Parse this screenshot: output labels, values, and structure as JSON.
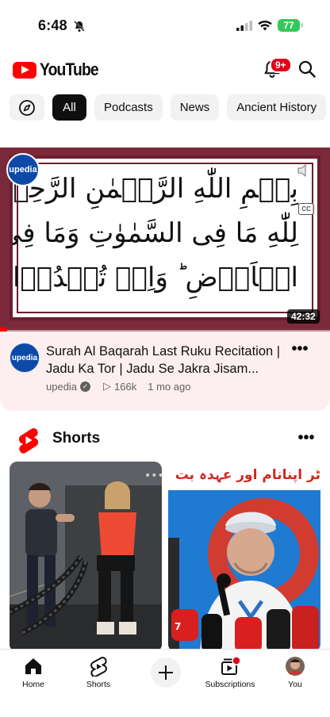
{
  "status_bar": {
    "time": "6:48",
    "battery": "77",
    "mute_icon": "bell-slash-icon",
    "signal_icon": "cellular-signal-icon",
    "wifi_icon": "wifi-icon"
  },
  "header": {
    "logo_text": "YouTube",
    "notification_count": "9+",
    "bell_icon": "bell-icon",
    "search_icon": "search-icon",
    "brand_color": "#ff0000"
  },
  "chips": {
    "explore_icon": "compass-icon",
    "items": [
      {
        "label": "All",
        "active": true
      },
      {
        "label": "Podcasts",
        "active": false
      },
      {
        "label": "News",
        "active": false
      },
      {
        "label": "Ancient History",
        "active": false
      }
    ]
  },
  "video": {
    "thumbnail_lines": [
      "بِسۡمِ اللّٰهِ الرَّحۡمٰنِ الرَّحِيۡمِ",
      "لِلّٰهِ مَا فِى السَّمٰوٰتِ وَمَا فِى",
      "الۡاَرۡضِ ؕ وَاِنۡ تُبۡدُوۡا مَا فِىۡۤ"
    ],
    "thumbnail_badge": "upedia",
    "duration": "42:32",
    "cc_label": "CC",
    "progress": 0.01,
    "channel_avatar": "upedia",
    "title": "Surah Al Baqarah Last Ruku Recitation | Jadu Ka Tor | Jadu Se Jakra Jisam...",
    "channel": "upedia",
    "views": "166k",
    "age": "1 mo ago",
    "more_label": "•••"
  },
  "shorts": {
    "title": "Shorts",
    "more_label": "•••",
    "cards": [
      {
        "description": "gym-workout-thumbnail"
      },
      {
        "header_text": "ٹر اپنانام اور عہدہ بت"
      }
    ]
  },
  "bottom_nav": {
    "items": [
      {
        "label": "Home",
        "icon": "home-icon"
      },
      {
        "label": "Shorts",
        "icon": "shorts-icon"
      },
      {
        "label": "",
        "icon": "plus-icon"
      },
      {
        "label": "Subscriptions",
        "icon": "subscriptions-icon"
      },
      {
        "label": "You",
        "icon": "avatar"
      }
    ]
  }
}
